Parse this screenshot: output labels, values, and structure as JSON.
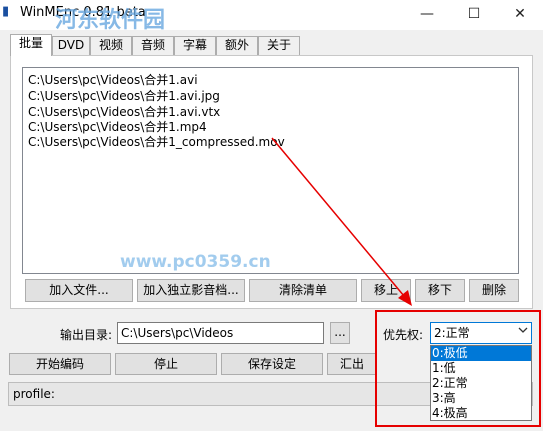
{
  "window": {
    "title": "WinMEnc 0.81 beta",
    "watermark": "河东软件园",
    "min_glyph": "—",
    "max_glyph": "☐",
    "close_glyph": "✕"
  },
  "tabs": [
    {
      "label": "批量"
    },
    {
      "label": "DVD"
    },
    {
      "label": "视频"
    },
    {
      "label": "音频"
    },
    {
      "label": "字幕"
    },
    {
      "label": "额外"
    },
    {
      "label": "关于"
    }
  ],
  "file_list": [
    "C:\\Users\\pc\\Videos\\合并1.avi",
    "C:\\Users\\pc\\Videos\\合并1.avi.jpg",
    "C:\\Users\\pc\\Videos\\合并1.avi.vtx",
    "C:\\Users\\pc\\Videos\\合并1.mp4",
    "C:\\Users\\pc\\Videos\\合并1_compressed.mov"
  ],
  "site_watermark": "www.pc0359.cn",
  "list_buttons": {
    "add_file": "加入文件...",
    "add_av": "加入独立影音档...",
    "clear": "清除清单",
    "move_up": "移上",
    "move_down": "移下",
    "delete": "删除"
  },
  "output": {
    "label": "输出目录:",
    "value": "C:\\Users\\pc\\Videos",
    "browse": "..."
  },
  "priority": {
    "label": "优先权:",
    "selected": "2:正常",
    "options": [
      "0:极低",
      "1:低",
      "2:正常",
      "3:高",
      "4:极高"
    ]
  },
  "bottom_buttons": {
    "start": "开始编码",
    "stop": "停止",
    "save": "保存设定",
    "export": "汇出"
  },
  "status": {
    "profile": "profile:"
  },
  "colors": {
    "accent": "#0078d7",
    "highlight": "#e60000"
  }
}
